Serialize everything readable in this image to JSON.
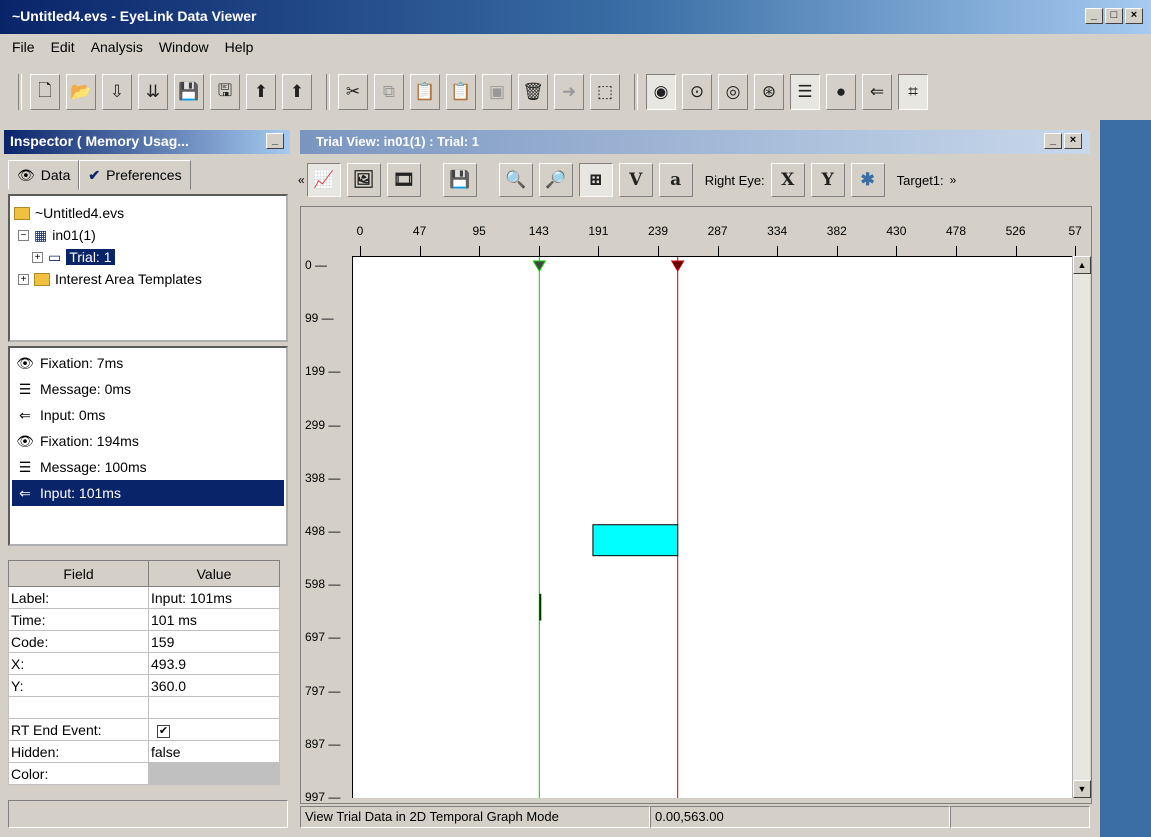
{
  "window": {
    "title": "~Untitled4.evs - EyeLink Data Viewer",
    "controls": [
      "_",
      "□",
      "×"
    ]
  },
  "menu": [
    "File",
    "Edit",
    "Analysis",
    "Window",
    "Help"
  ],
  "toolbar": {
    "groups": [
      [
        "new-icon",
        "open-icon",
        "import-icon",
        "import-multiple-icon",
        "save-icon",
        "save-all-icon",
        "export-icon",
        "export-2-icon"
      ],
      [
        "cut-icon",
        "copy-icon",
        "paste-icon",
        "paste-special-icon",
        "duplicate-icon",
        "delete-icon",
        "move-icon",
        "select-icon"
      ],
      [
        "fixation-icon",
        "saccade-icon",
        "blink-icon",
        "sample-icon",
        "message-icon",
        "interest-area-icon",
        "input-icon",
        "target-icon"
      ]
    ]
  },
  "inspector": {
    "title": "Inspector ( Memory Usag...",
    "tabs": [
      "Data",
      "Preferences"
    ],
    "tree": {
      "root": "~Untitled4.evs",
      "session": "in01(1)",
      "trial": "Trial: 1",
      "templates": "Interest Area Templates"
    },
    "events": [
      {
        "label": "Fixation: 7ms",
        "icon": "eye-icon"
      },
      {
        "label": "Message: 0ms",
        "icon": "message-icon"
      },
      {
        "label": "Input: 0ms",
        "icon": "input-icon"
      },
      {
        "label": "Fixation: 194ms",
        "icon": "eye-icon"
      },
      {
        "label": "Message: 100ms",
        "icon": "message-icon"
      },
      {
        "label": "Input: 101ms",
        "icon": "input-icon"
      }
    ],
    "field_header": "Field",
    "value_header": "Value",
    "fields": [
      {
        "field": "Label:",
        "value": "Input: 101ms"
      },
      {
        "field": "Time:",
        "value": "101 ms"
      },
      {
        "field": "Code:",
        "value": "159"
      },
      {
        "field": "X:",
        "value": "493.9"
      },
      {
        "field": "Y:",
        "value": "360.0"
      },
      {
        "field": "",
        "value": ""
      },
      {
        "field": "RT End Event:",
        "value": "checked"
      },
      {
        "field": "Hidden:",
        "value": "false"
      },
      {
        "field": "Color:",
        "value": ""
      }
    ]
  },
  "trial_view": {
    "title": "Trial View: in01(1) : Trial: 1",
    "right_eye_label": "Right Eye:",
    "x_button": "X",
    "y_button": "Y",
    "target_label": "Target1:",
    "v_button": "V",
    "a_button": "a"
  },
  "chart_data": {
    "type": "scatter",
    "x_ticks": [
      "0",
      "47",
      "95",
      "143",
      "191",
      "239",
      "287",
      "334",
      "382",
      "430",
      "478",
      "526",
      "57"
    ],
    "y_ticks": [
      "0",
      "99",
      "199",
      "299",
      "398",
      "498",
      "598",
      "697",
      "797",
      "897",
      "997"
    ],
    "xlim": [
      0,
      574
    ],
    "ylim": [
      0,
      1050
    ],
    "lines": [
      {
        "x": 143,
        "color": "#00cc00"
      },
      {
        "x": 254,
        "color": "#cc0000"
      }
    ],
    "fixation_rect": {
      "x0": 186,
      "x1": 254,
      "y0": 498,
      "y1": 556,
      "color": "#00ffff"
    },
    "small_mark": {
      "x": 143,
      "y0": 650,
      "y1": 700
    }
  },
  "status": {
    "mode": "View Trial Data in 2D Temporal Graph Mode",
    "coords": "0.00,563.00"
  }
}
